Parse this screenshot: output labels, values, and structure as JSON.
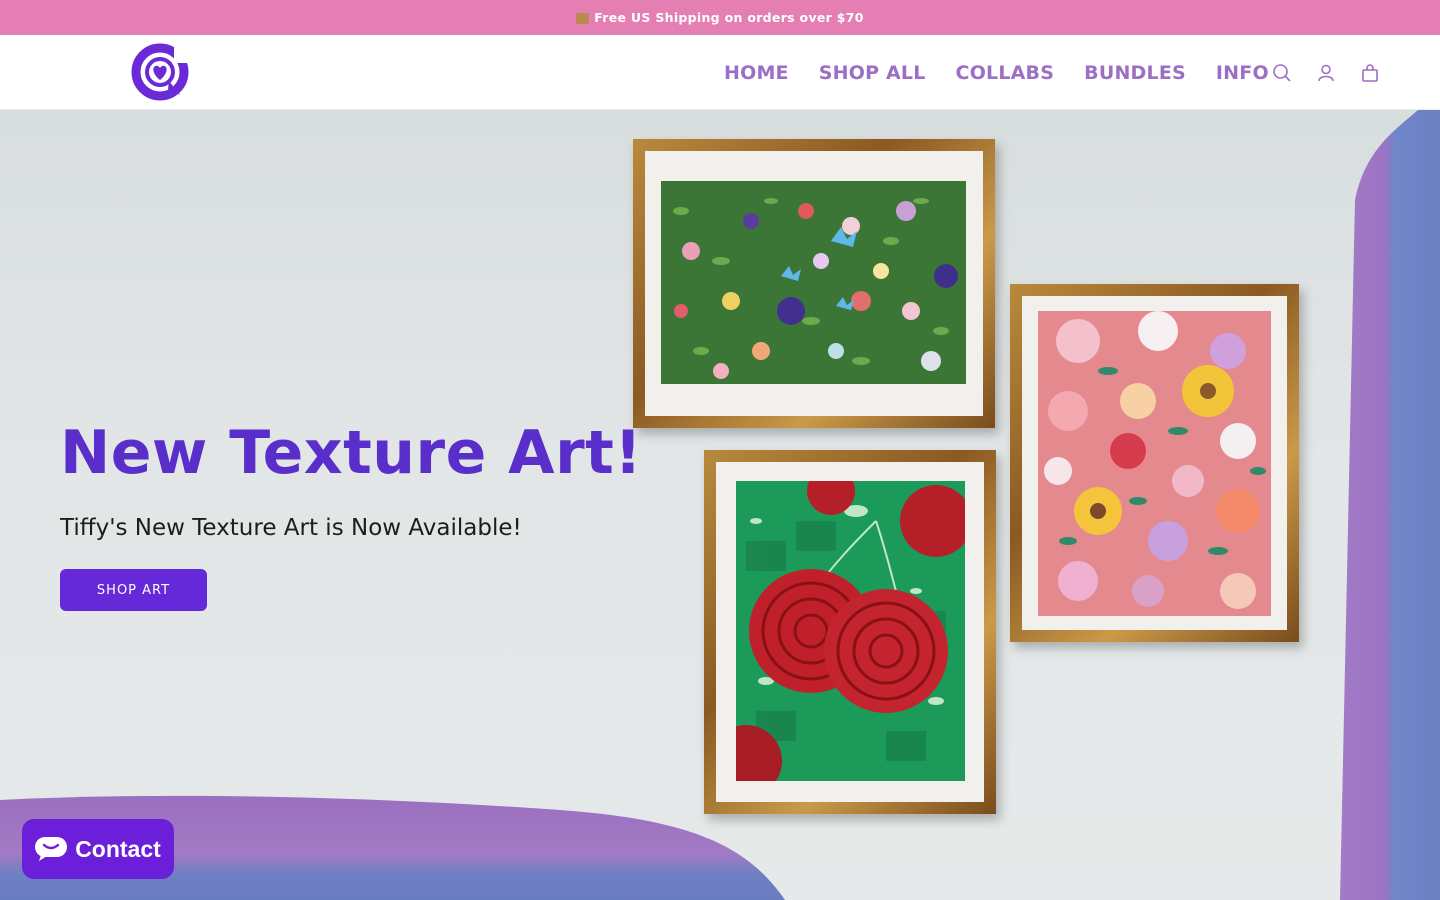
{
  "announcement": {
    "icon": "package-icon",
    "text": "Free US Shipping on orders over $70"
  },
  "header": {
    "logo": "heart-chat-logo",
    "nav": [
      {
        "label": "HOME"
      },
      {
        "label": "SHOP ALL"
      },
      {
        "label": "COLLABS"
      },
      {
        "label": "BUNDLES"
      },
      {
        "label": "INFO"
      }
    ],
    "icons": [
      "search-icon",
      "account-icon",
      "cart-icon"
    ]
  },
  "hero": {
    "title": "New Texture Art!",
    "subtitle": "Tiffy's New Texture Art is Now Available!",
    "button_label": "SHOP ART"
  },
  "chat_widget": {
    "label": "Contact",
    "icon": "chat-bubble-icon"
  },
  "colors": {
    "announcement_bg": "#e57fb3",
    "brand_purple": "#6529d9",
    "title_purple": "#5a2ecb",
    "nav_purple": "#9a6fc4"
  }
}
